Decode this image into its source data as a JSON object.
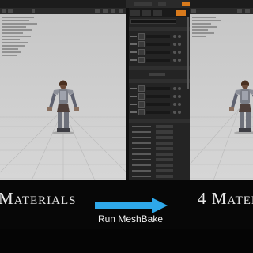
{
  "caption": {
    "left_text": "Materials",
    "right_text": "4 Materi",
    "arrow_label": "Run MeshBake"
  },
  "colors": {
    "viewport_bg": "#cccccc",
    "panel_bg": "#242424",
    "active_tab": "#d87a1c",
    "arrow": "#2ea8ea",
    "caption_bg": "#070707"
  },
  "icons": [
    "right-arrow-icon",
    "material-thumbnail-icon"
  ]
}
